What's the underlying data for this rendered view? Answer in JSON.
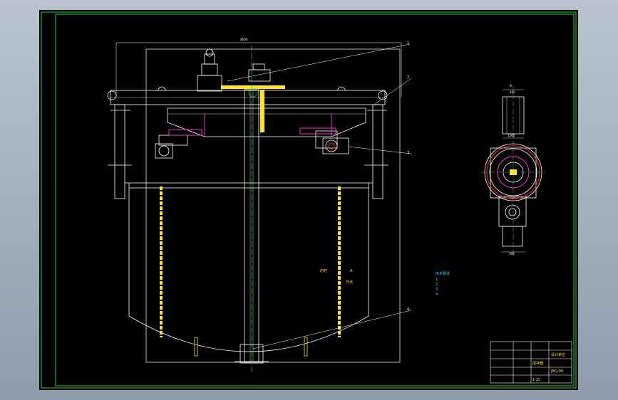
{
  "drawing": {
    "top_dimension": "4600",
    "leaders": [
      "1",
      "2",
      "3",
      "4"
    ],
    "side_view_tag": "B",
    "side_top_dim": "400",
    "side_mid_dim": "1200",
    "side_bot_dim": "300",
    "tank_labels": [
      "内衬",
      "A",
      "节点"
    ],
    "notes_title": "技术要求",
    "notes_lines": [
      "1.",
      "2.",
      "3.",
      "4."
    ]
  },
  "title_block": {
    "title": "搅拌器",
    "drawing_no": "JBQ-00",
    "scale": "1:25",
    "company": "设计单位"
  },
  "colors": {
    "frame": "#19d64a",
    "outline": "#ffffff",
    "yellow": "#ffe51c",
    "magenta": "#ff2bd8",
    "red": "#ff2222",
    "cyan": "#29d0ff",
    "green": "#21e24b"
  }
}
